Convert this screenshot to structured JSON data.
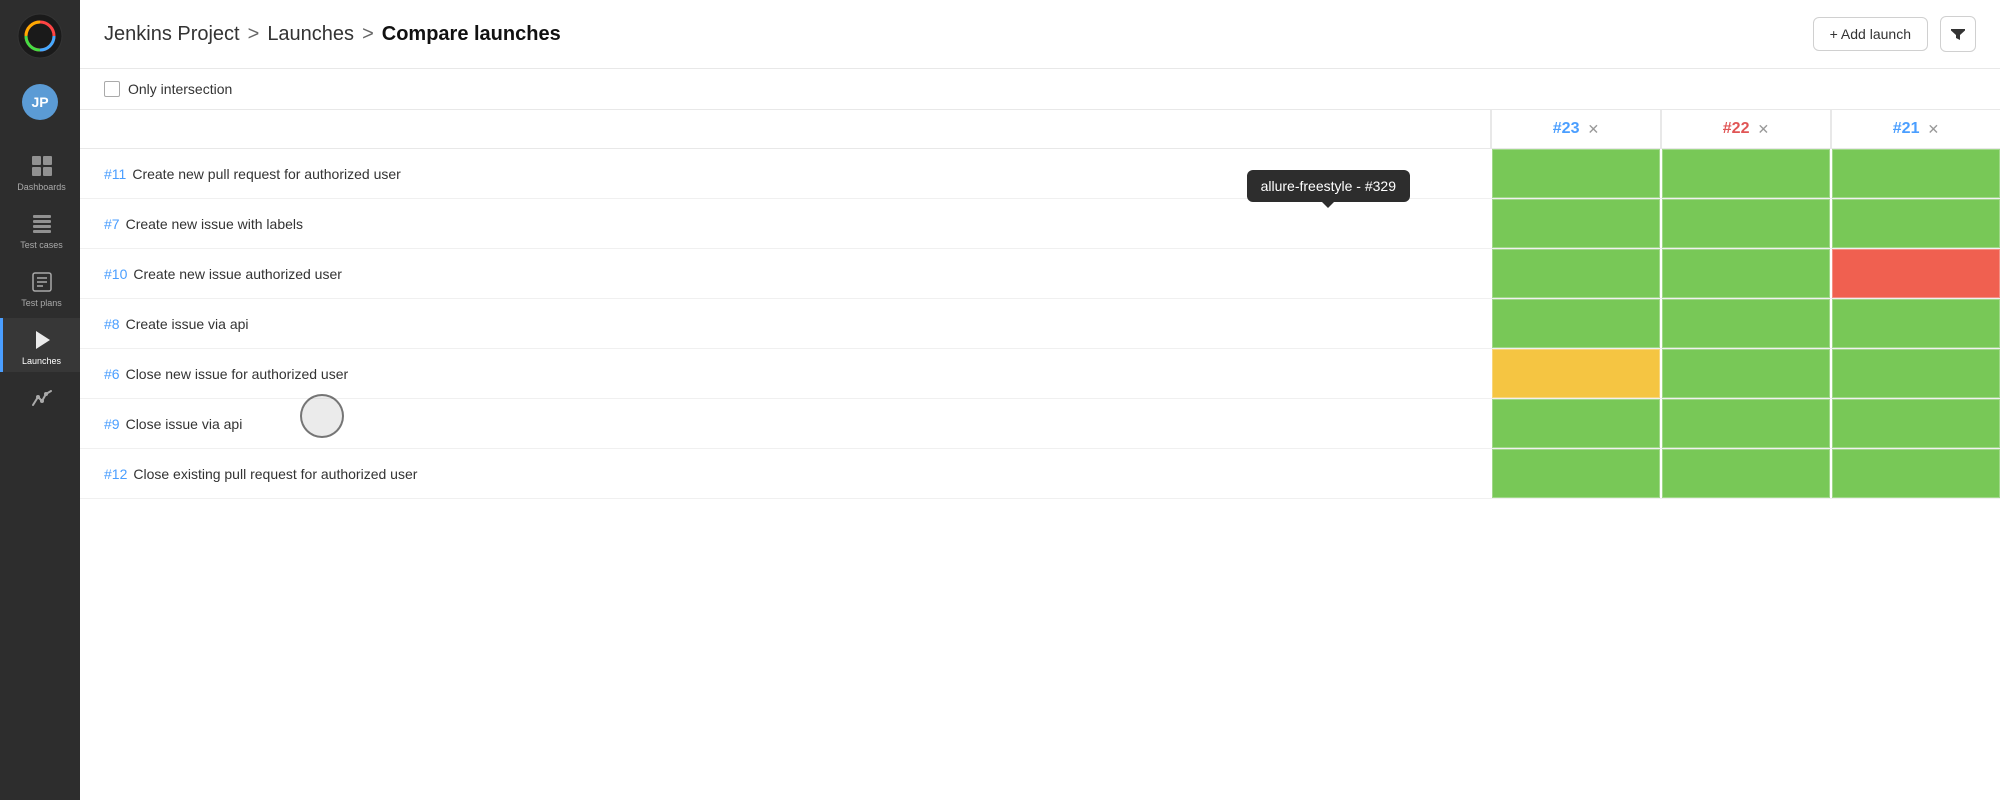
{
  "sidebar": {
    "logo_alt": "App Logo",
    "avatar_initials": "JP",
    "nav_items": [
      {
        "id": "dashboards",
        "label": "Dashboards",
        "icon": "dashboard-icon",
        "active": false
      },
      {
        "id": "test-cases",
        "label": "Test cases",
        "icon": "test-cases-icon",
        "active": false
      },
      {
        "id": "test-plans",
        "label": "Test plans",
        "icon": "test-plans-icon",
        "active": false
      },
      {
        "id": "launches",
        "label": "Launches",
        "icon": "launches-icon",
        "active": true
      },
      {
        "id": "analytics",
        "label": "Analytics",
        "icon": "analytics-icon",
        "active": false
      }
    ]
  },
  "header": {
    "breadcrumb": {
      "project": "Jenkins Project",
      "separator1": ">",
      "launches": "Launches",
      "separator2": ">",
      "current": "Compare launches"
    },
    "add_launch_label": "+ Add launch",
    "filter_icon": "filter-icon"
  },
  "filter_bar": {
    "checkbox_label": "Only intersection"
  },
  "launches": [
    {
      "id": "#23",
      "color": "blue"
    },
    {
      "id": "#22",
      "color": "red"
    },
    {
      "id": "#21",
      "color": "blue"
    }
  ],
  "tooltip": {
    "text": "allure-freestyle - #329"
  },
  "test_rows": [
    {
      "id": "#11",
      "name": "Create new pull request for authorized user",
      "cells": [
        "green",
        "green",
        "green"
      ]
    },
    {
      "id": "#7",
      "name": "Create new issue with labels",
      "cells": [
        "green",
        "green",
        "green"
      ]
    },
    {
      "id": "#10",
      "name": "Create new issue authorized user",
      "cells": [
        "green",
        "green",
        "red"
      ]
    },
    {
      "id": "#8",
      "name": "Create issue via api",
      "cells": [
        "green",
        "green",
        "green"
      ]
    },
    {
      "id": "#6",
      "name": "Close new issue for authorized user",
      "cells": [
        "orange",
        "green",
        "green"
      ]
    },
    {
      "id": "#9",
      "name": "Close issue via api",
      "cells": [
        "green",
        "green",
        "green"
      ]
    },
    {
      "id": "#12",
      "name": "Close existing pull request for authorized user",
      "cells": [
        "green",
        "green",
        "green"
      ]
    }
  ]
}
